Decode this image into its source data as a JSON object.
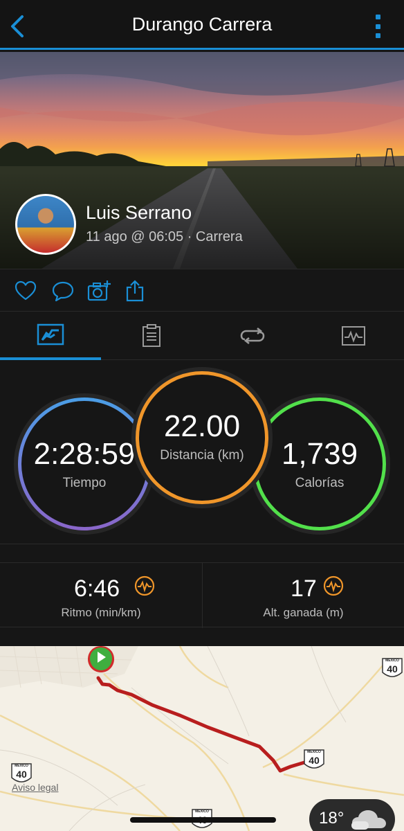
{
  "header": {
    "title": "Durango Carrera"
  },
  "activity": {
    "user_name": "Luis Serrano",
    "meta": "11 ago @ 06:05 · Carrera"
  },
  "stats": {
    "time": {
      "value": "2:28:59",
      "label": "Tiempo"
    },
    "distance": {
      "value": "22.00",
      "label": "Distancia (km)"
    },
    "calories": {
      "value": "1,739",
      "label": "Calorías"
    }
  },
  "secondary": {
    "pace": {
      "value": "6:46",
      "label": "Ritmo (min/km)"
    },
    "elevation": {
      "value": "17",
      "label": "Alt. ganada (m)"
    }
  },
  "map": {
    "legal": "Aviso legal",
    "route_shield_label": "40",
    "shield_top_text": "MEXICO"
  },
  "weather": {
    "temperature": "18°",
    "icon": "cloud-icon"
  },
  "colors": {
    "accent": "#1a8fd6",
    "time_ring": "#6f7fd8",
    "distance_ring": "#f0962a",
    "calories_ring": "#52e04b",
    "route": "#b81e1e",
    "start_marker": "#3fae3f"
  }
}
